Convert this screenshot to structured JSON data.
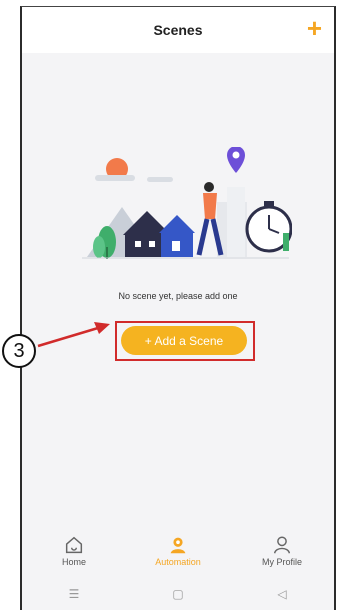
{
  "header": {
    "title": "Scenes",
    "add_icon": "plus-icon"
  },
  "main": {
    "empty_message": "No scene yet, please add one",
    "add_button_label": "+ Add a Scene"
  },
  "annotation": {
    "step_number": "3"
  },
  "tabbar": {
    "items": [
      {
        "label": "Home",
        "icon": "home-icon",
        "active": false
      },
      {
        "label": "Automation",
        "icon": "automation-icon",
        "active": true
      },
      {
        "label": "My Profile",
        "icon": "profile-icon",
        "active": false
      }
    ]
  },
  "system_nav": {
    "menu": "☰",
    "home": "▢",
    "back": "◁"
  },
  "colors": {
    "accent": "#f5a623",
    "button": "#f5b320",
    "highlight": "#d12b2b"
  }
}
